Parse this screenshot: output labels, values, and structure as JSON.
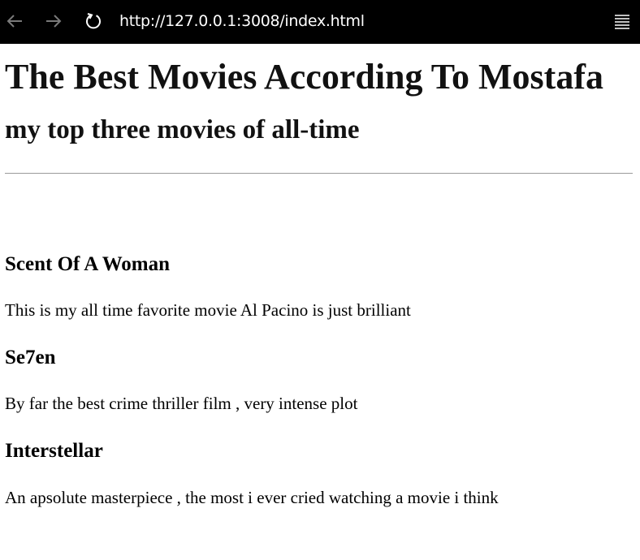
{
  "browser": {
    "url": "http://127.0.0.1:3008/index.html",
    "icons": [
      "back-arrow-icon",
      "forward-arrow-icon",
      "reload-icon",
      "menu-icon"
    ]
  },
  "page": {
    "title": "The Best Movies According To Mostafa",
    "subtitle": "my top three movies of all-time",
    "movies": [
      {
        "name": "Scent Of A Woman",
        "description": "This is my all time favorite movie Al Pacino is just brilliant"
      },
      {
        "name": "Se7en",
        "description": "By far the best crime thriller film , very intense plot"
      },
      {
        "name": "Interstellar",
        "description": "An apsolute masterpiece , the most i ever cried watching a movie i think"
      }
    ]
  }
}
